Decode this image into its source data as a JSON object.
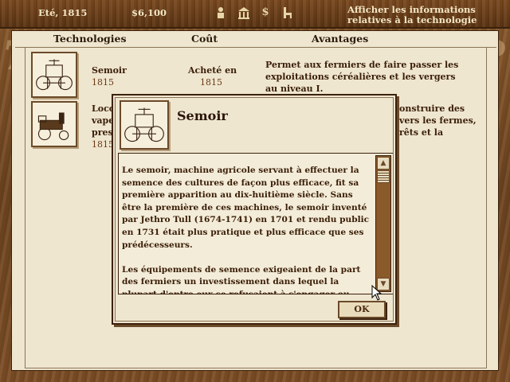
{
  "status_bar": {
    "date": "Eté, 1815",
    "money": "$6,100",
    "info_text": "Afficher les informations relatives à la technologie",
    "icons": [
      "person-icon",
      "building-icon",
      "dollar-icon",
      "chair-icon"
    ]
  },
  "table": {
    "columns": [
      "Technologies",
      "Coût",
      "Avantages"
    ],
    "rows": [
      {
        "name": "Semoir",
        "year": "1815",
        "cost_label": "Acheté en",
        "cost_year": "1815",
        "advantage": "Permet aux fermiers de faire passer les exploitations céréalières et les vergers au niveau I."
      },
      {
        "name_partial": "Loco",
        "line2_partial": "vape",
        "line3_partial": "pres",
        "year_partial": "1815",
        "advantage_line1": "onstruire des",
        "advantage_line2": "vers les fermes,",
        "advantage_line3": "rêts et la"
      }
    ]
  },
  "dialog": {
    "title": "Semoir",
    "paragraphs": [
      "Le semoir, machine agricole servant à effectuer la semence des cultures de façon plus efficace, fit sa première apparition au dix-huitième siècle. Sans être la première de ces machines, le semoir inventé par Jethro Tull (1674-1741) en 1701 et rendu public en 1731 était plus pratique et plus efficace que ses prédécesseurs.",
      "Les équipements de semence exigeaient de la part des fermiers un investissement dans lequel la plupart d'entre eux se refusaient à s'engager ou"
    ],
    "ok_label": "OK"
  },
  "colors": {
    "parchment": "#efe6d0",
    "wood": "#7b4a20",
    "text_brown": "#3a1e08"
  }
}
